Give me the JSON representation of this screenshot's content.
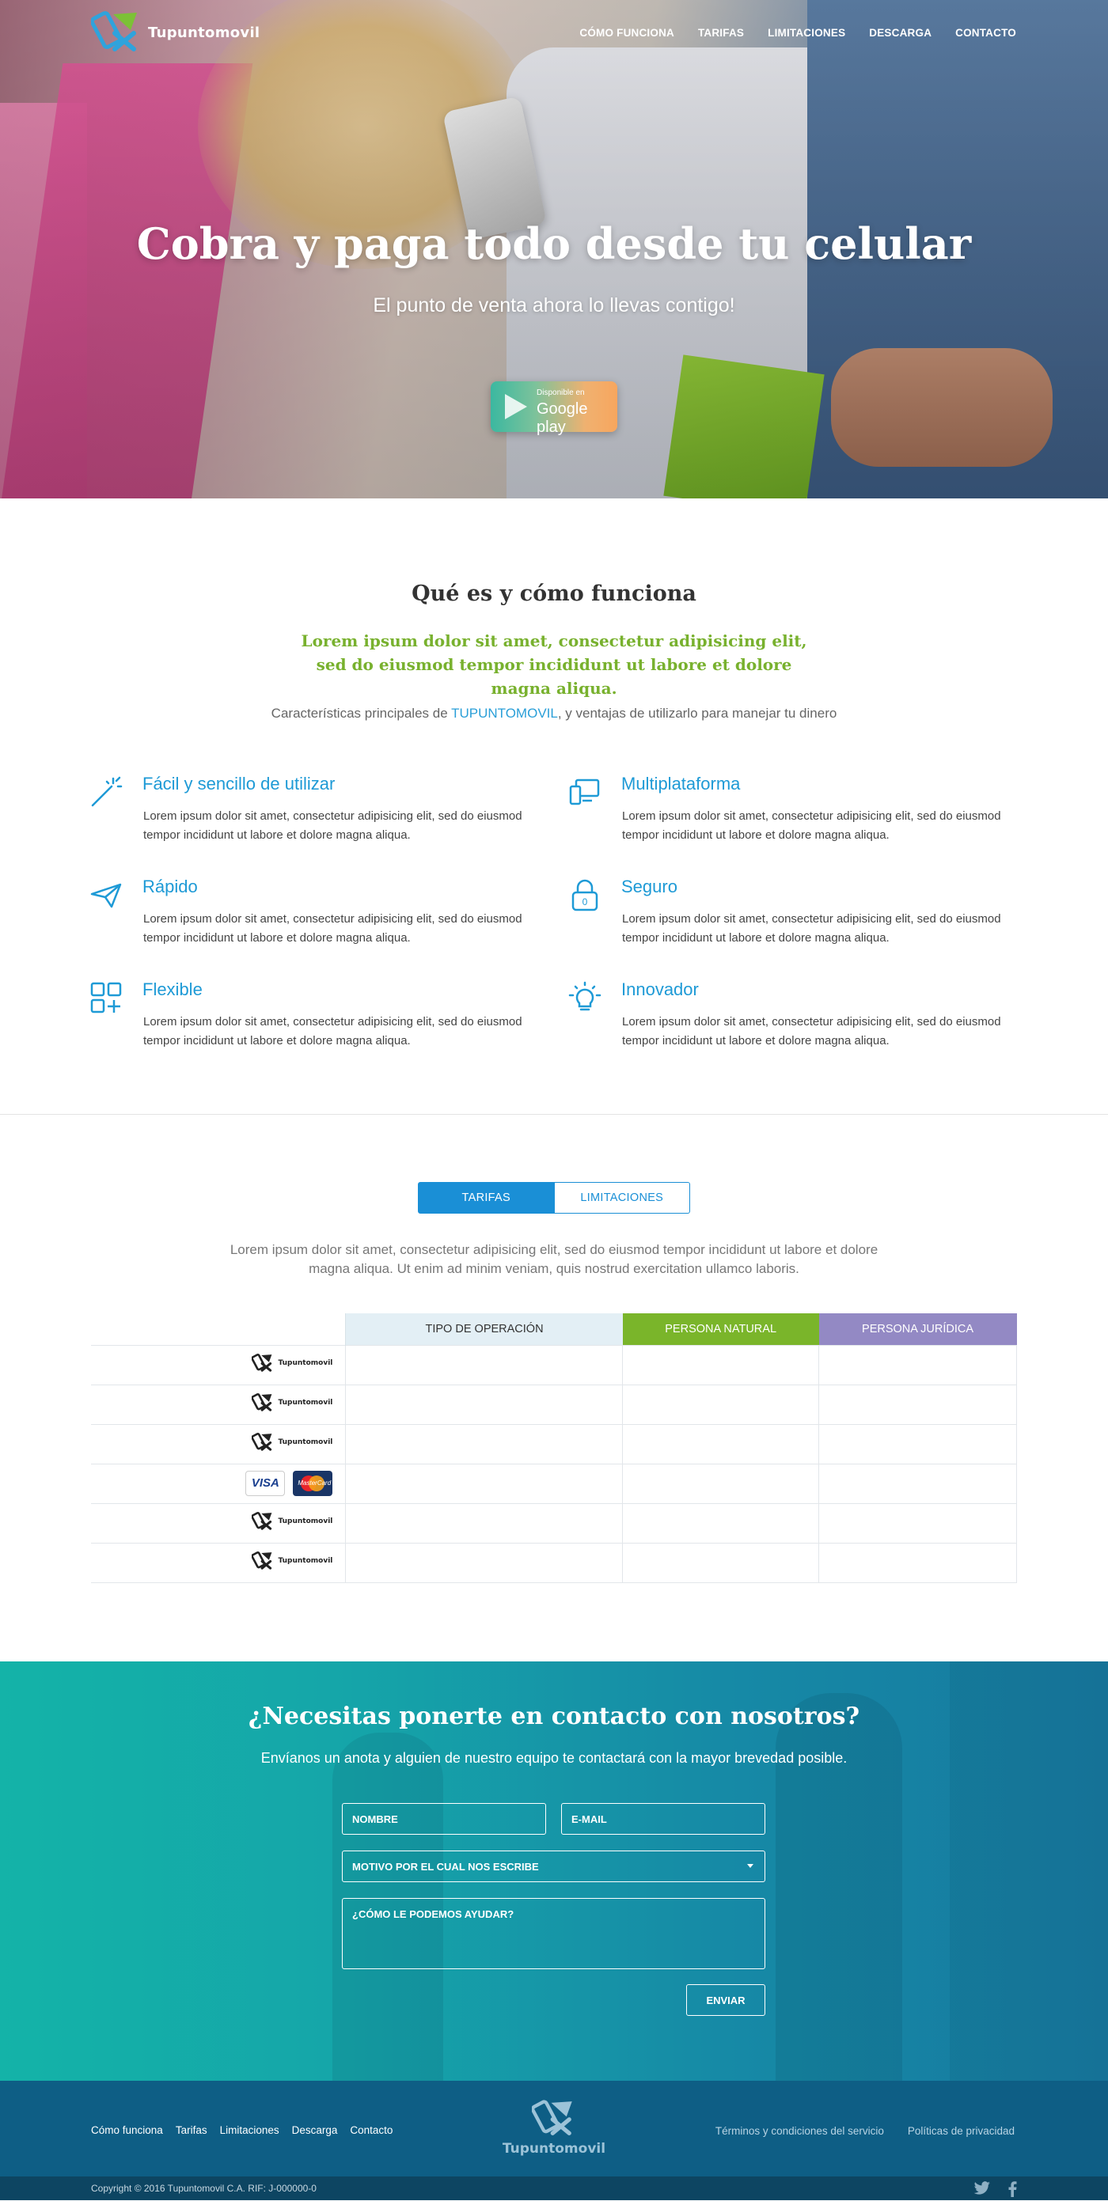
{
  "header": {
    "logo_text": "Tupuntomovil",
    "nav": [
      "CÓMO FUNCIONA",
      "TARIFAS",
      "LIMITACIONES",
      "DESCARGA",
      "CONTACTO"
    ]
  },
  "hero": {
    "title": "Cobra y paga todo desde tu celular",
    "subtitle": "El punto de venta ahora lo llevas contigo!",
    "store_badge": {
      "small": "Disponible en",
      "big": "Google play"
    }
  },
  "about": {
    "title": "Qué es y cómo funciona",
    "lead": "Lorem ipsum dolor sit amet, consectetur adipisicing elit, sed do eiusmod tempor incididunt ut labore et dolore magna aliqua.",
    "intro_before": "Características principales de ",
    "intro_brand": "TUPUNTOMOVIL",
    "intro_after": ", y ventajas de utilizarlo para manejar tu dinero",
    "features": [
      {
        "icon": "magic-wand-icon",
        "title": "Fácil y sencillo de utilizar",
        "text": "Lorem ipsum dolor sit amet, consectetur adipisicing elit, sed do eiusmod tempor incididunt ut labore et dolore magna aliqua."
      },
      {
        "icon": "devices-icon",
        "title": "Multiplataforma",
        "text": "Lorem ipsum dolor sit amet, consectetur adipisicing elit, sed do eiusmod tempor incididunt ut labore et dolore magna aliqua."
      },
      {
        "icon": "paper-plane-icon",
        "title": "Rápido",
        "text": "Lorem ipsum dolor sit amet, consectetur adipisicing elit, sed do eiusmod tempor incididunt ut labore et dolore magna aliqua."
      },
      {
        "icon": "padlock-icon",
        "title": "Seguro",
        "text": "Lorem ipsum dolor sit amet, consectetur adipisicing elit, sed do eiusmod tempor incididunt ut labore et dolore magna aliqua."
      },
      {
        "icon": "grid-plus-icon",
        "title": "Flexible",
        "text": "Lorem ipsum dolor sit amet, consectetur adipisicing elit, sed do eiusmod tempor incididunt ut labore et dolore magna aliqua."
      },
      {
        "icon": "lightbulb-icon",
        "title": "Innovador",
        "text": "Lorem ipsum dolor sit amet, consectetur adipisicing elit, sed do eiusmod tempor incididunt ut labore et dolore magna aliqua."
      }
    ]
  },
  "rates": {
    "tabs": [
      "TARIFAS",
      "LIMITACIONES"
    ],
    "active_tab": "TARIFAS",
    "description": "Lorem ipsum dolor sit amet, consectetur adipisicing elit, sed do eiusmod tempor incididunt ut labore et dolore magna aliqua. Ut enim ad minim veniam, quis nostrud exercitation ullamco laboris.",
    "columns": [
      "TIPO DE OPERACIÓN",
      "PERSONA NATURAL",
      "PERSONA JURÍDICA"
    ],
    "row_logo_text": "Tupuntomovil",
    "card_visa": "VISA",
    "card_mc": "MasterCard",
    "colors": {
      "operation": "#e3eff5",
      "natural": "#7ab52a",
      "juridica": "#9389c4"
    }
  },
  "contact": {
    "title": "¿Necesitas ponerte en contacto con nosotros?",
    "subtitle": "Envíanos un anota y alguien de nuestro equipo te contactará con la mayor brevedad posible.",
    "name_placeholder": "NOMBRE",
    "email_placeholder": "E-MAIL",
    "reason_placeholder": "MOTIVO POR EL CUAL NOS ESCRIBE",
    "message_placeholder": "¿CÓMO LE PODEMOS AYUDAR?",
    "send_label": "ENVIAR"
  },
  "footer": {
    "nav": [
      "Cómo funciona",
      "Tarifas",
      "Limitaciones",
      "Descarga",
      "Contacto"
    ],
    "logo_text": "Tupuntomovil",
    "legal": [
      "Términos y condiciones del servicio",
      "Políticas de privacidad"
    ],
    "copyright": "Copyright © 2016 Tupuntomovil C.A. RIF: J-000000-0",
    "social": [
      "twitter-icon",
      "facebook-icon"
    ]
  }
}
